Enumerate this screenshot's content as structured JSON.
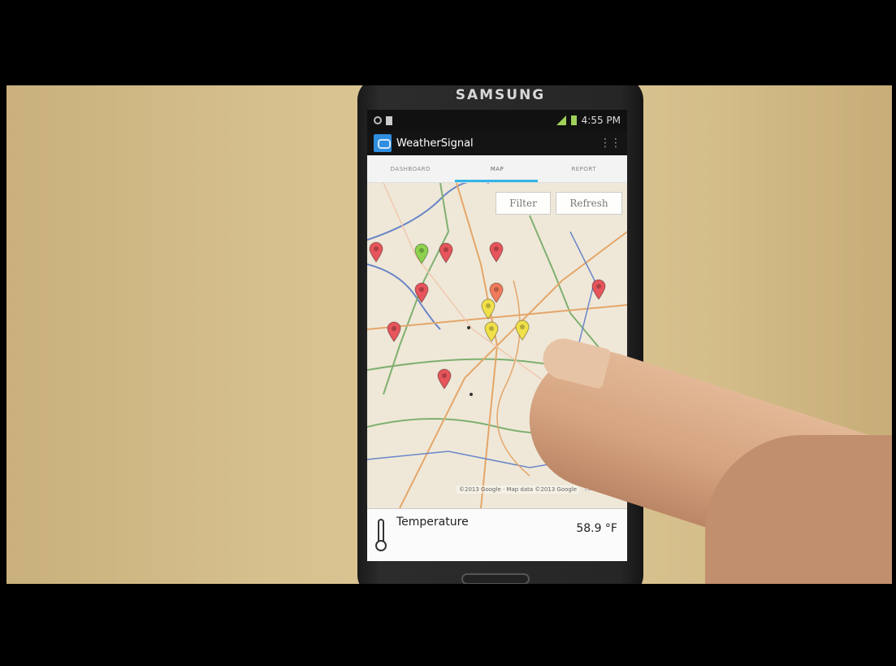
{
  "phone": {
    "brand": "SAMSUNG"
  },
  "status_bar": {
    "time": "4:55 PM"
  },
  "app_bar": {
    "title": "WeatherSignal",
    "app_icon": "weathersignal-app-icon",
    "overflow_icon": "overflow-menu-icon"
  },
  "tabs": [
    {
      "label": "DASHBOARD",
      "active": false
    },
    {
      "label": "MAP",
      "active": true
    },
    {
      "label": "REPORT",
      "active": false
    }
  ],
  "map": {
    "filter_label": "Filter",
    "refresh_label": "Refresh",
    "zoom_in_label": "+",
    "zoom_out_label": "−",
    "attribution": "©2013 Google · Map data ©2013 Google",
    "markers": [
      {
        "color": "#e5555b"
      },
      {
        "color": "#8ed14e"
      },
      {
        "color": "#e5555b"
      },
      {
        "color": "#e5555b"
      },
      {
        "color": "#e5555b"
      },
      {
        "color": "#f07a5a"
      },
      {
        "color": "#f0e04a"
      },
      {
        "color": "#f0e04a"
      },
      {
        "color": "#f0e04a"
      },
      {
        "color": "#e5555b"
      },
      {
        "color": "#e5555b"
      },
      {
        "color": "#e5555b"
      }
    ]
  },
  "bottom_panel": {
    "label": "Temperature",
    "value": "58.9 °F",
    "icon": "thermometer-icon"
  }
}
